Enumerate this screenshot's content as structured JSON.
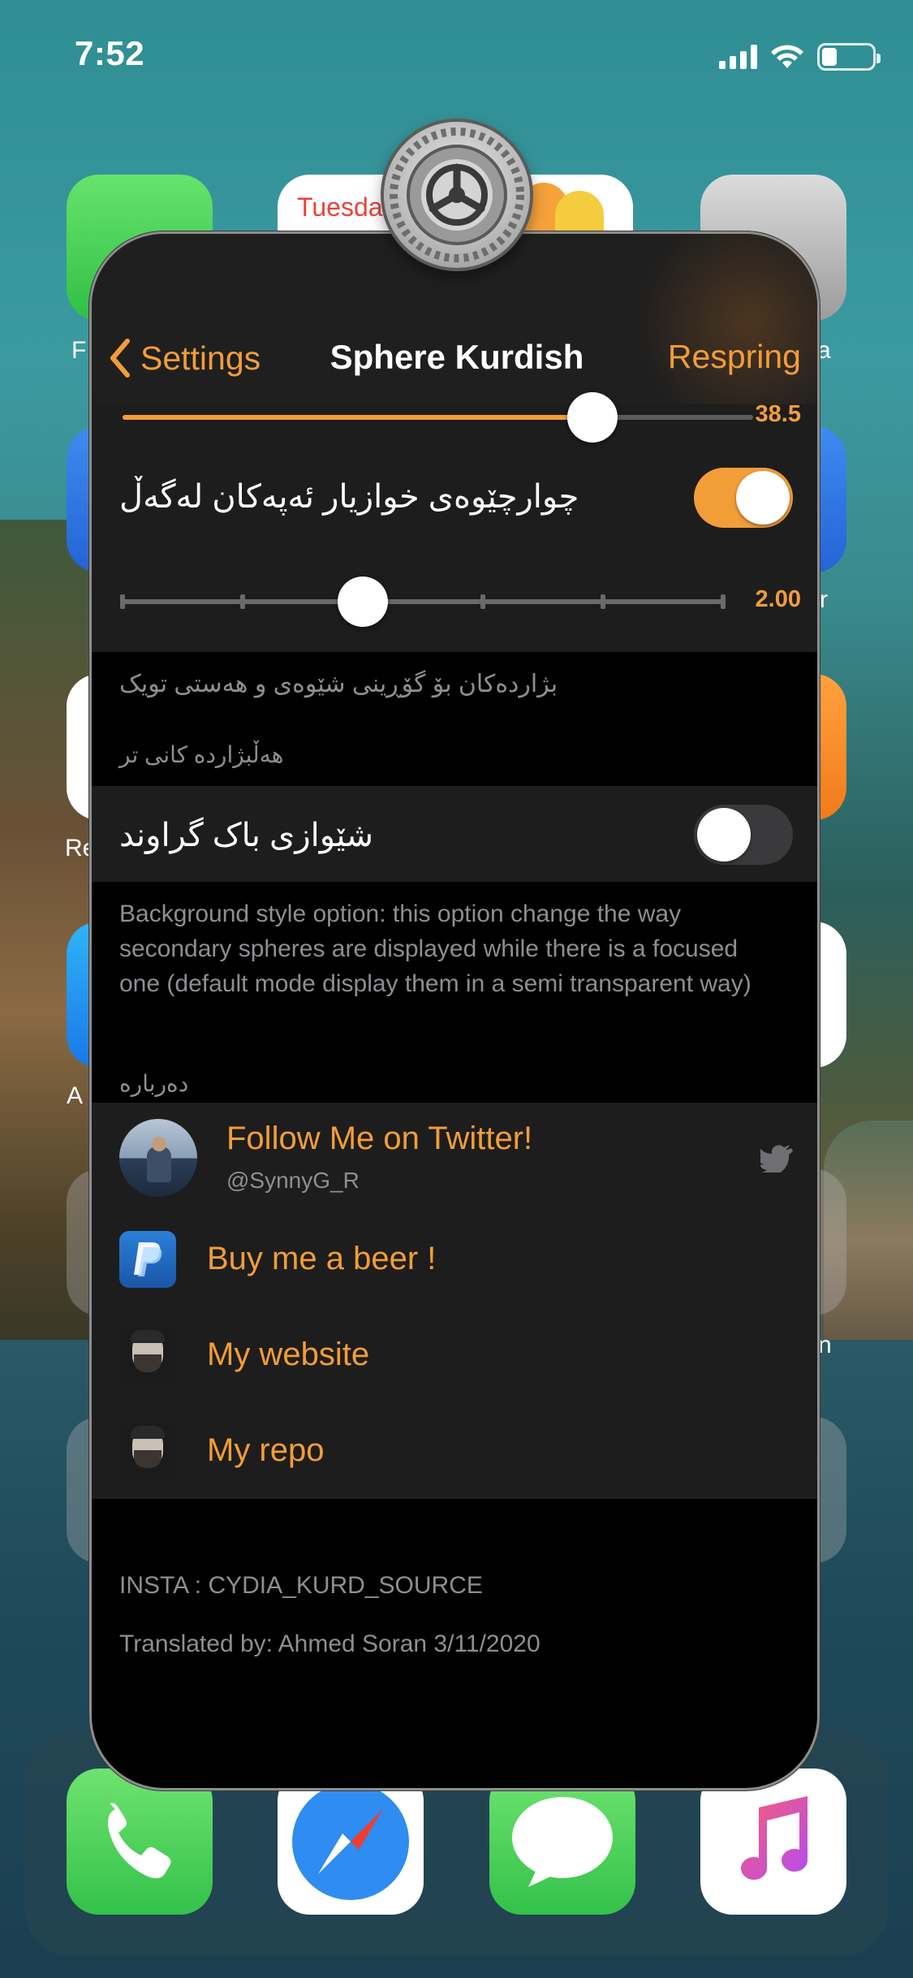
{
  "status_bar": {
    "time": "7:52"
  },
  "home_screen": {
    "labels": {
      "left_row1": "F",
      "left_row3": "Re",
      "left_row4": "A",
      "right_row1": "a",
      "right_row2": "r",
      "right_row6": "n"
    },
    "calendar_day": "Tuesda"
  },
  "sphere": {
    "nav": {
      "back_label": "Settings",
      "title": "Sphere Kurdish",
      "right_button": "Respring"
    },
    "slider_top": {
      "value_label": "38.5",
      "fraction": 0.745
    },
    "custom_corner_toggle": {
      "label": "چوارچێوەی خوازیار ئەپەکان لەگەڵ",
      "on": true
    },
    "corner_slider": {
      "value_label": "2.00",
      "fraction": 0.4
    },
    "size_footer": "بژاردەکان بۆ گۆڕینی شێوەی و هەستی تویک",
    "other_options_header": "هەڵبژاردە کانی تر",
    "background_toggle": {
      "label": "شێوازی باک گراوند",
      "on": false
    },
    "background_footer": "Background style option: this option change the way secondary spheres are displayed while there is a focused one (default mode display them in a semi transparent way)",
    "about_header": "دەربارە",
    "twitter": {
      "title": "Follow Me on Twitter!",
      "handle": "@SynnyG_R"
    },
    "links": [
      {
        "label": "Buy me a beer !",
        "icon": "paypal-icon"
      },
      {
        "label": "My website",
        "icon": "avatar-icon"
      },
      {
        "label": "My repo",
        "icon": "avatar-icon"
      }
    ],
    "credits": {
      "insta": "INSTA : CYDIA_KURD_SOURCE",
      "translated": "Translated by: Ahmed Soran 3/11/2020"
    }
  },
  "colors": {
    "accent": "#f29d38",
    "card_bg": "#1d1d1d",
    "nav_bg": "#1f1f1f"
  }
}
